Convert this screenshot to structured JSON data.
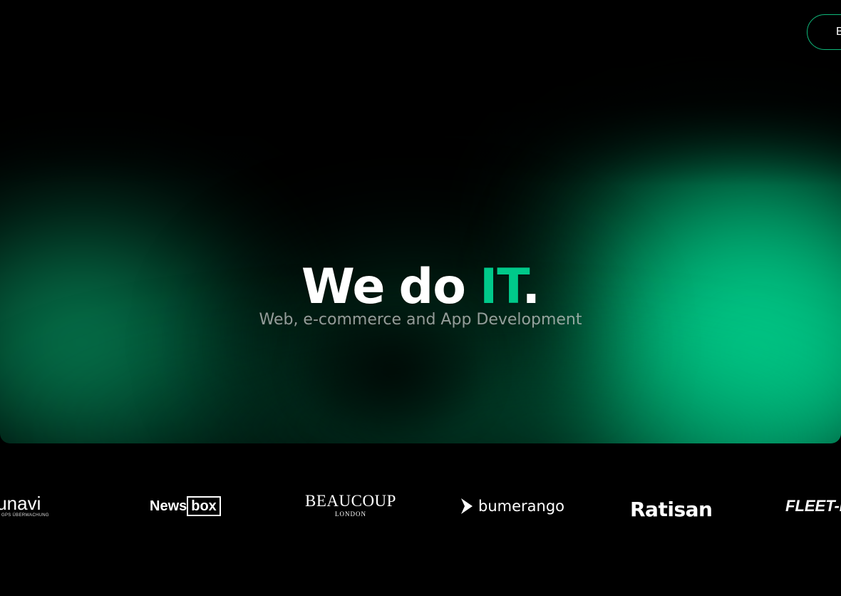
{
  "header": {
    "cta_label": "Book"
  },
  "hero": {
    "headline_part1": "We",
    "headline_part2": "do",
    "headline_accent": "IT",
    "headline_period": ".",
    "subtitle": "Web, e-commerce and App Development",
    "accent_color": "#00c98a"
  },
  "clients": {
    "logos": [
      {
        "name": "tunavi",
        "tagline": "GPS ÜBERWACHUNG"
      },
      {
        "name_part1": "News",
        "name_part2": "box"
      },
      {
        "name": "BEAUCOUP",
        "tagline": "LONDON"
      },
      {
        "name": "bumerango"
      },
      {
        "name": "Ratisan"
      },
      {
        "name": "FLEET-DE"
      }
    ]
  }
}
